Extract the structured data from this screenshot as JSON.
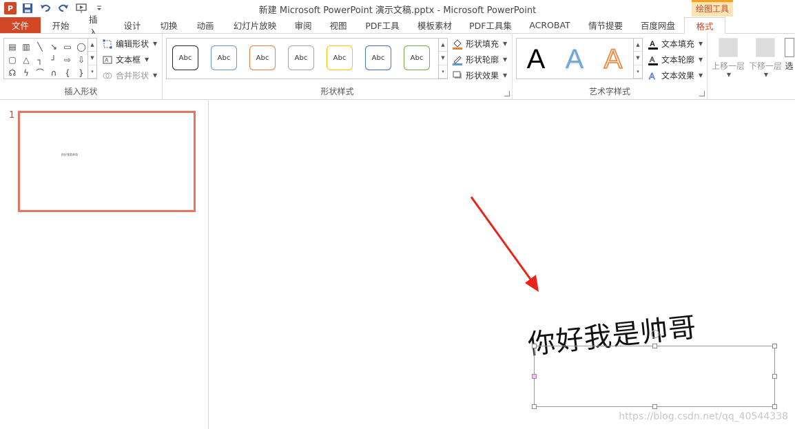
{
  "window": {
    "title": "新建 Microsoft PowerPoint 演示文稿.pptx - Microsoft PowerPoint",
    "app_icon": "P",
    "context_header": "绘图工具"
  },
  "tabs": [
    {
      "label": "文件"
    },
    {
      "label": "开始"
    },
    {
      "label": "插入"
    },
    {
      "label": "设计"
    },
    {
      "label": "切换"
    },
    {
      "label": "动画"
    },
    {
      "label": "幻灯片放映"
    },
    {
      "label": "审阅"
    },
    {
      "label": "视图"
    },
    {
      "label": "PDF工具"
    },
    {
      "label": "模板素材"
    },
    {
      "label": "PDF工具集"
    },
    {
      "label": "ACROBAT"
    },
    {
      "label": "情节提要"
    },
    {
      "label": "百度网盘"
    },
    {
      "label": "格式"
    }
  ],
  "ribbon": {
    "insert_shapes": {
      "label": "插入形状",
      "edit_shape": "编辑形状",
      "text_box": "文本框",
      "merge_shapes": "合并形状"
    },
    "shape_styles": {
      "label": "形状样式",
      "swatches": [
        {
          "text": "Abc",
          "color": "#222222"
        },
        {
          "text": "Abc",
          "color": "#5b9bd5"
        },
        {
          "text": "Abc",
          "color": "#ed7d31"
        },
        {
          "text": "Abc",
          "color": "#a5a5a5"
        },
        {
          "text": "Abc",
          "color": "#ffc000"
        },
        {
          "text": "Abc",
          "color": "#4472c4"
        },
        {
          "text": "Abc",
          "color": "#70ad47"
        }
      ],
      "fill": "形状填充",
      "outline": "形状轮廓",
      "effects": "形状效果"
    },
    "wordart_styles": {
      "label": "艺术字样式",
      "samples": [
        {
          "text": "A",
          "color": "#000000"
        },
        {
          "text": "A",
          "color": "#5b9bd5"
        },
        {
          "text": "A",
          "color": "#ed7d31"
        }
      ],
      "text_fill": "文本填充",
      "text_outline": "文本轮廓",
      "text_effects": "文本效果"
    },
    "arrange": {
      "bring_forward": "上移一层",
      "send_backward": "下移一层",
      "selection_pane": "选"
    }
  },
  "slides_panel": {
    "slide_number": "1",
    "thumb_text": "你好我是帅哥"
  },
  "slide": {
    "wordart_text": "你好我是帅哥"
  },
  "watermark": "https://blog.csdn.net/qq_40544338",
  "colors": {
    "accent": "#d24726",
    "arrow": "#e8241c"
  }
}
